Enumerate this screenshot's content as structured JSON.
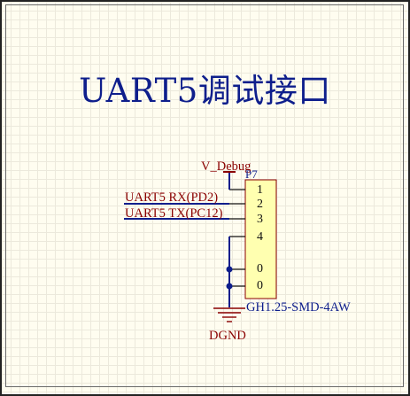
{
  "title": "UART5调试接口",
  "connector": {
    "designator": "P7",
    "part": "GH1.25-SMD-4AW",
    "pins": [
      "1",
      "2",
      "3",
      "4",
      "0",
      "0"
    ]
  },
  "nets": {
    "power": "V_Debug",
    "rx": "UART5 RX(PD2)",
    "tx": "UART5 TX(PC12)",
    "ground": "DGND"
  },
  "colors": {
    "wire": "#0E1E8C",
    "net_label": "#8A0000",
    "body_fill": "#FFFFB0",
    "body_stroke": "#8A0000"
  }
}
